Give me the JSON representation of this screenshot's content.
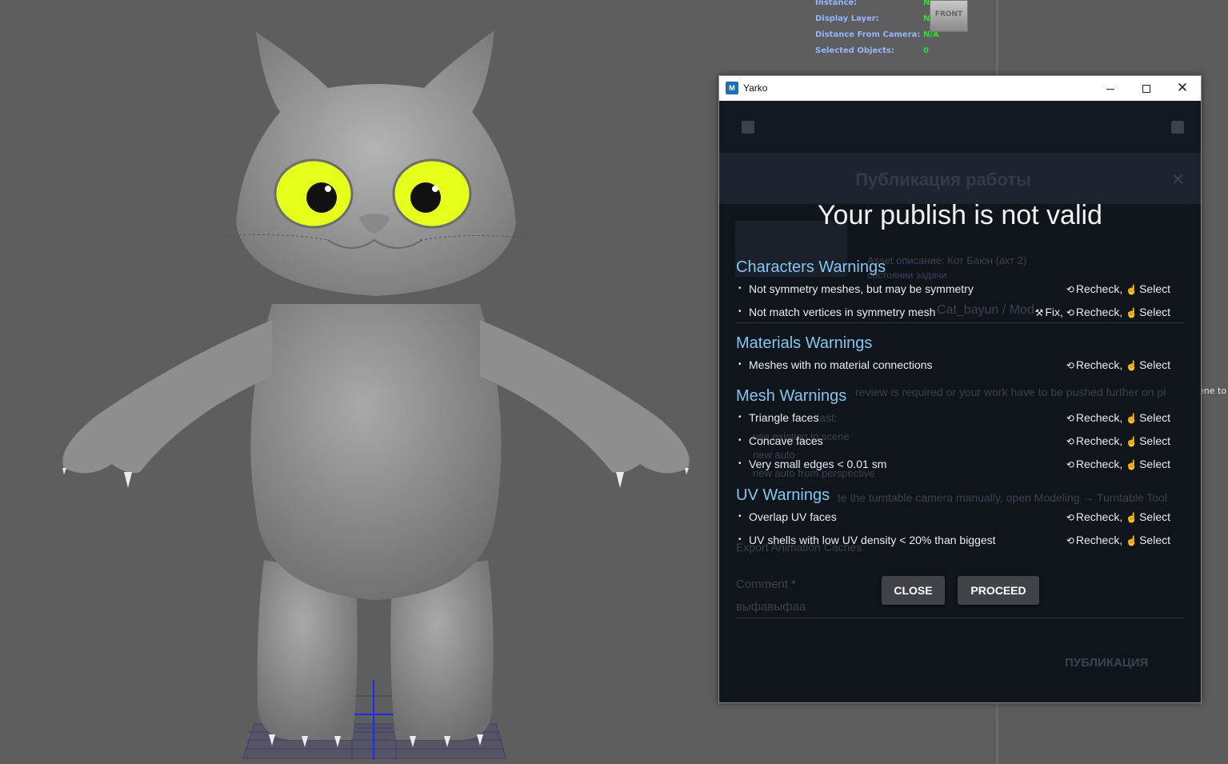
{
  "hud": {
    "rows": [
      {
        "label": "Instance:",
        "value": "N/A"
      },
      {
        "label": "Display Layer:",
        "value": "N/A"
      },
      {
        "label": "Distance From Camera:",
        "value": "N/A"
      },
      {
        "label": "Selected Objects:",
        "value": "0"
      }
    ],
    "cube_label": "FRONT"
  },
  "side_text": "ene to",
  "window": {
    "title": "Yarko",
    "app_icon": "M"
  },
  "behind": {
    "title": "Публикация работы",
    "asset_desc": "Asset описание: Кот Баюн (акт 2)",
    "state": "состоянии задачи",
    "path": "Cat_bayun / Mod",
    "review_text": "review is required or your work have to be pushed further on pi",
    "last": "last:",
    "opt1": "use existing in scene",
    "opt2": "new auto",
    "opt3": "new auto from perspective",
    "turntable": "te the turntable camera manually, open Modeling → Turntable Tool",
    "export": "Export Animation Caches",
    "comment_label": "Comment *",
    "comment_value": "выфавыфаа",
    "publish_btn": "ПУБЛИКАЦИЯ"
  },
  "dialog": {
    "heading": "Your publish is not valid",
    "sections": [
      {
        "title": "Characters Warnings",
        "items": [
          {
            "text": "Not symmetry meshes, but may be symmetry",
            "fix": "",
            "recheck": "Recheck,",
            "select": "Select"
          },
          {
            "text": "Not match vertices in symmetry mesh",
            "fix": "Fix,",
            "recheck": "Recheck,",
            "select": "Select"
          }
        ]
      },
      {
        "title": "Materials Warnings",
        "items": [
          {
            "text": "Meshes with no material connections",
            "fix": "",
            "recheck": "Recheck,",
            "select": "Select"
          }
        ]
      },
      {
        "title": "Mesh Warnings",
        "items": [
          {
            "text": "Triangle faces",
            "fix": "",
            "recheck": "Recheck,",
            "select": "Select"
          },
          {
            "text": "Concave faces",
            "fix": "",
            "recheck": "Recheck,",
            "select": "Select"
          },
          {
            "text": "Very small edges < 0.01 sm",
            "fix": "",
            "recheck": "Recheck,",
            "select": "Select"
          }
        ]
      },
      {
        "title": "UV Warnings",
        "items": [
          {
            "text": "Overlap UV faces",
            "fix": "",
            "recheck": "Recheck,",
            "select": "Select"
          },
          {
            "text": "UV shells with low UV density < 20% than biggest",
            "fix": "",
            "recheck": "Recheck,",
            "select": "Select"
          }
        ]
      }
    ],
    "close_label": "CLOSE",
    "proceed_label": "PROCEED"
  },
  "colors": {
    "section_title": "#83c6ee",
    "hud_label": "#93b6ff",
    "hud_value": "#26e626",
    "eye": "#e6ff1a"
  }
}
